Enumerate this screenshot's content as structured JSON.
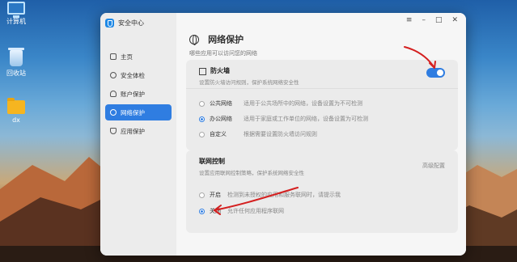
{
  "desktop": {
    "icons": [
      {
        "label": "计算机",
        "icon": "computer-icon"
      },
      {
        "label": "回收站",
        "icon": "trash-icon"
      },
      {
        "label": "dx",
        "icon": "folder-icon"
      }
    ]
  },
  "window": {
    "title": "安全中心",
    "controls": {
      "menu": "≡",
      "minimize": "–",
      "maximize": "□",
      "close": "✕"
    }
  },
  "sidebar": {
    "items": [
      {
        "label": "主页",
        "icon": "home-icon",
        "active": false
      },
      {
        "label": "安全体检",
        "icon": "scan-icon",
        "active": false
      },
      {
        "label": "账户保护",
        "icon": "user-icon",
        "active": false
      },
      {
        "label": "网络保护",
        "icon": "globe-icon",
        "active": true
      },
      {
        "label": "应用保护",
        "icon": "shield-icon",
        "active": false
      }
    ]
  },
  "page": {
    "title": "网络保护",
    "subtitle": "哪些应用可以访问您的网络"
  },
  "firewall": {
    "title": "防火墙",
    "desc": "设置防火墙访问规则，保护系统网络安全性",
    "enabled": true,
    "options": [
      {
        "name": "公共网络",
        "desc": "适用于公共场所中的网络，设备设置为不可检测",
        "selected": false
      },
      {
        "name": "办公网络",
        "desc": "适用于家庭或工作单位的网络，设备设置为可检测",
        "selected": true
      },
      {
        "name": "自定义",
        "desc": "根据需要设置防火墙访问规则",
        "selected": false
      }
    ]
  },
  "network_control": {
    "title": "联网控制",
    "desc": "设置应用联网控制策略，保护系统网络安全性",
    "advanced_link": "高级配置",
    "options": [
      {
        "name": "开启",
        "desc": "检测到未授权的应用和服务联网时，请提示我",
        "selected": false
      },
      {
        "name": "关闭",
        "desc": "允许任何应用程序联网",
        "selected": true
      }
    ]
  },
  "colors": {
    "accent": "#2f7de1",
    "annotation": "#d42020"
  }
}
